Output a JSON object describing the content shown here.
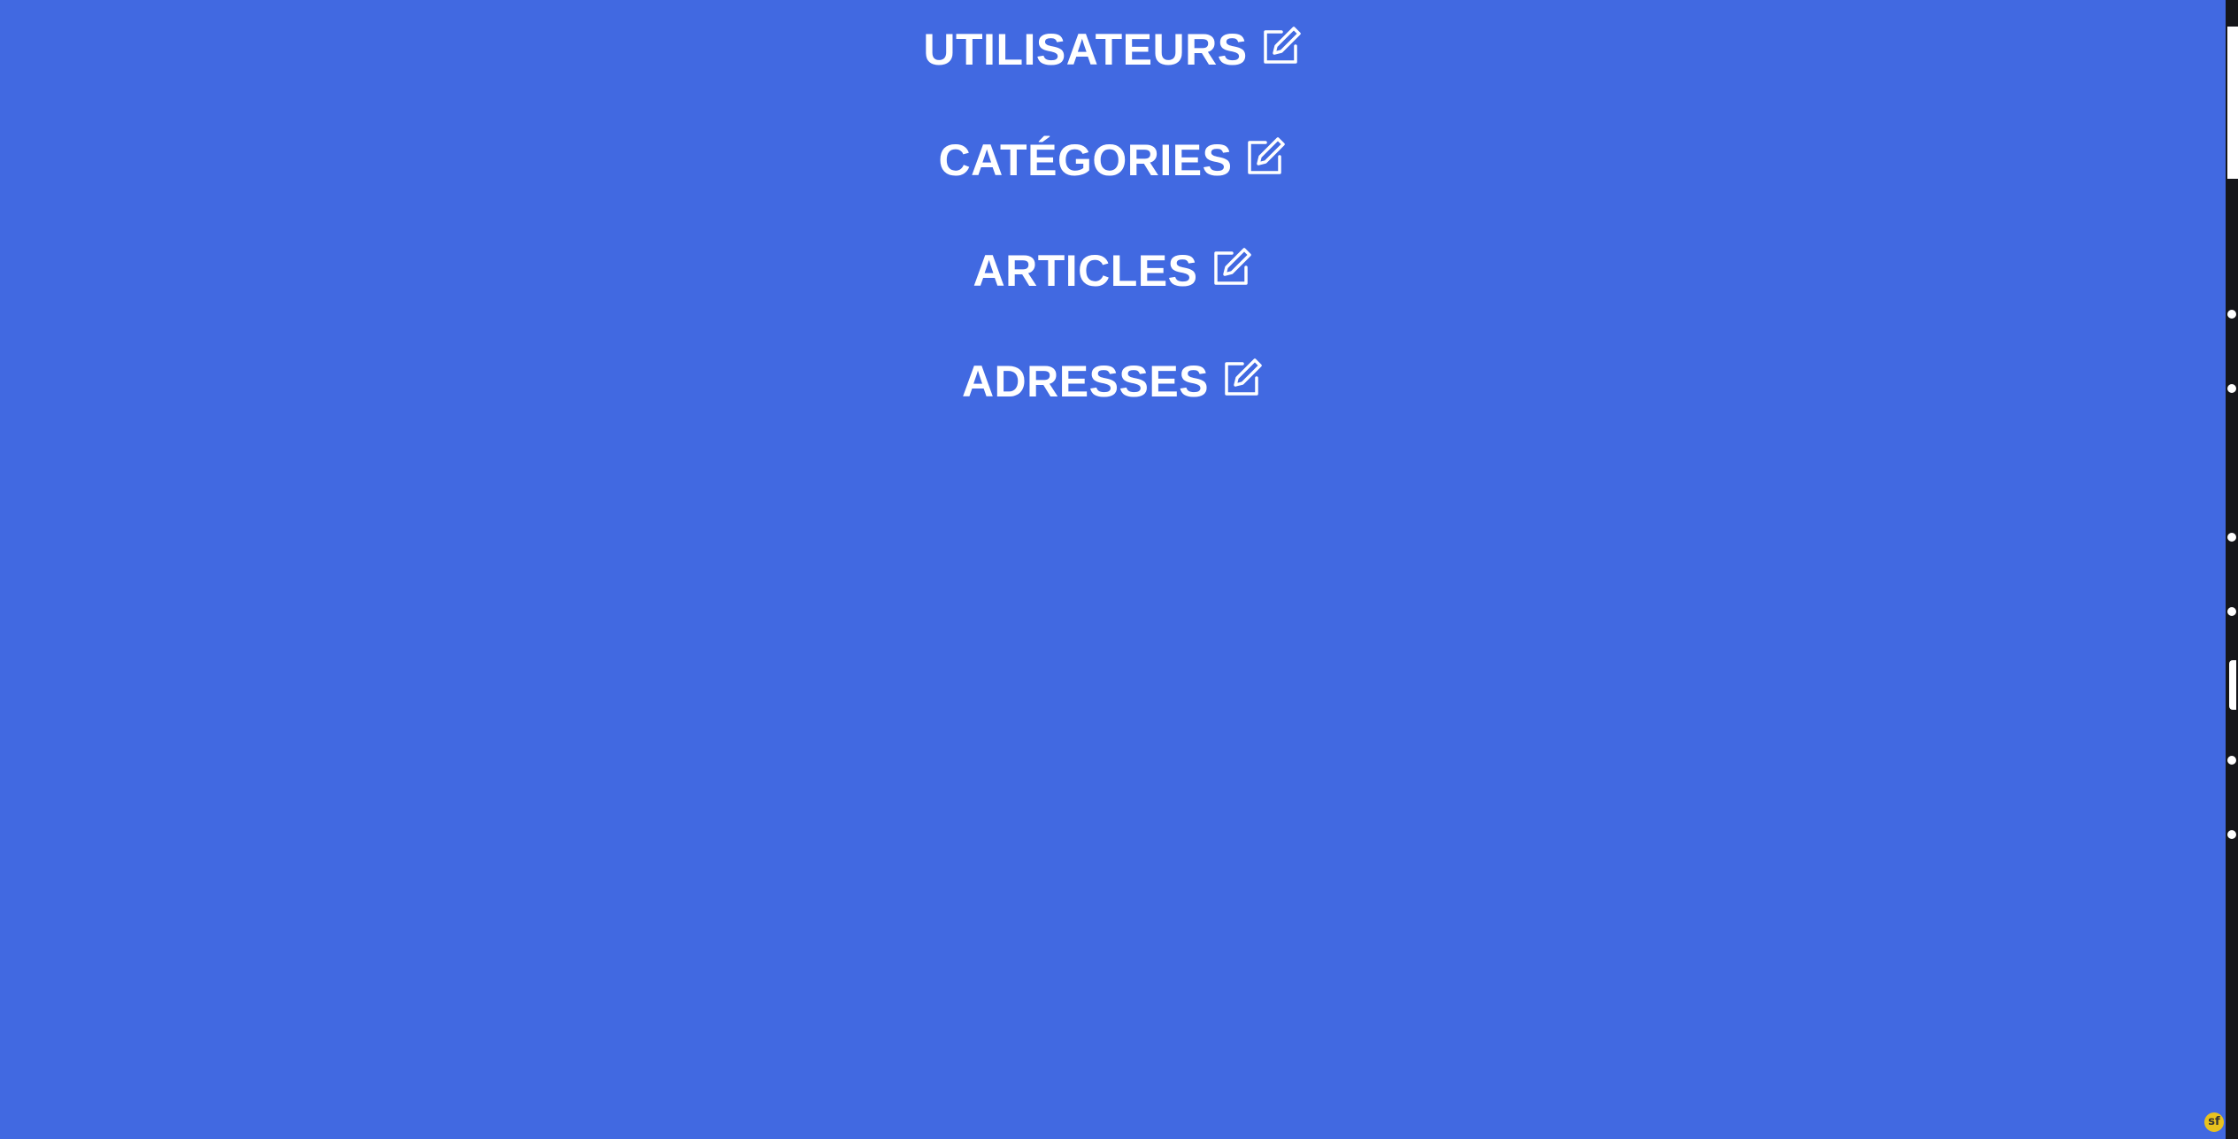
{
  "menu": {
    "items": [
      {
        "label": "UTILISATEURS",
        "icon": "edit-icon"
      },
      {
        "label": "CATÉGORIES",
        "icon": "edit-icon"
      },
      {
        "label": "ARTICLES",
        "icon": "edit-icon"
      },
      {
        "label": "ADRESSES",
        "icon": "edit-icon"
      }
    ]
  },
  "colors": {
    "background": "#4169e1",
    "text": "#ffffff",
    "strip": "#15161a",
    "badge": "#e8c21e"
  },
  "badge": {
    "icon": "symfony-icon",
    "text": "sf"
  }
}
